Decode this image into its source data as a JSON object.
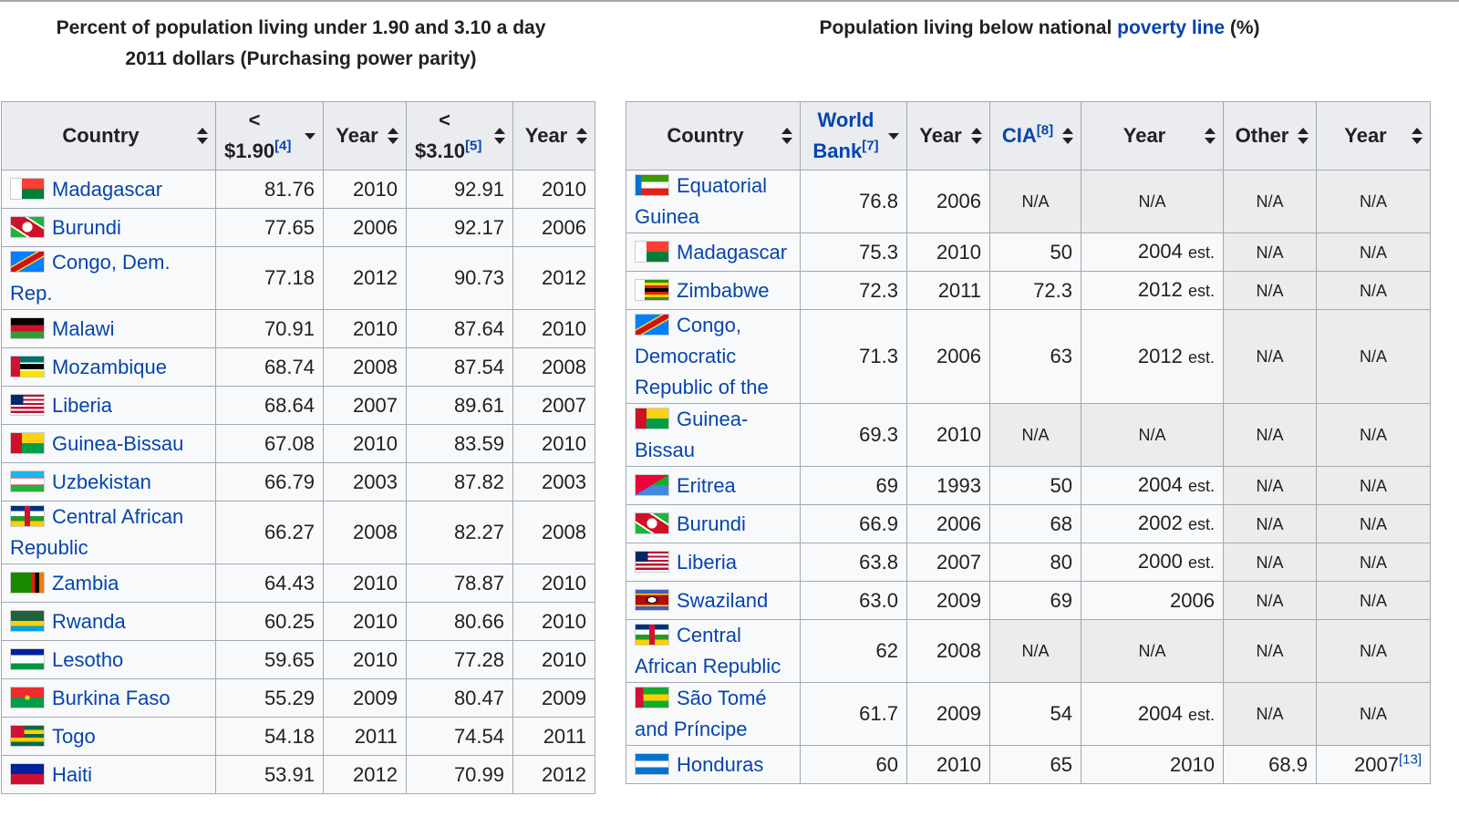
{
  "left_caption": {
    "line1": "Percent of population living under 1.90 and 3.10 a day",
    "line2": "2011 dollars (Purchasing power parity)"
  },
  "right_caption": {
    "pre": "Population living below national ",
    "link": "poverty line",
    "post": " (%)"
  },
  "colors": {
    "link": "#0645ad",
    "header_bg": "#eaecf0",
    "na_bg": "#ececec",
    "border": "#a2a9b1"
  },
  "table1": {
    "headers": {
      "country": "Country",
      "under190_a": "<",
      "under190_b": "$1.90",
      "under190_ref": "[4]",
      "year1": "Year",
      "under310_a": "<",
      "under310_b": "$3.10",
      "under310_ref": "[5]",
      "year2": "Year"
    },
    "rows": [
      {
        "country": "Madagascar",
        "flag": "madagascar-flag-icon",
        "v190": "81.76",
        "y1": "2010",
        "v310": "92.91",
        "y2": "2010"
      },
      {
        "country": "Burundi",
        "flag": "burundi-flag-icon",
        "v190": "77.65",
        "y1": "2006",
        "v310": "92.17",
        "y2": "2006"
      },
      {
        "country": "Congo, Dem. Rep.",
        "flag": "dr-congo-flag-icon",
        "v190": "77.18",
        "y1": "2012",
        "v310": "90.73",
        "y2": "2012"
      },
      {
        "country": "Malawi",
        "flag": "malawi-flag-icon",
        "v190": "70.91",
        "y1": "2010",
        "v310": "87.64",
        "y2": "2010"
      },
      {
        "country": "Mozambique",
        "flag": "mozambique-flag-icon",
        "v190": "68.74",
        "y1": "2008",
        "v310": "87.54",
        "y2": "2008"
      },
      {
        "country": "Liberia",
        "flag": "liberia-flag-icon",
        "v190": "68.64",
        "y1": "2007",
        "v310": "89.61",
        "y2": "2007"
      },
      {
        "country": "Guinea-Bissau",
        "flag": "guinea-bissau-flag-icon",
        "v190": "67.08",
        "y1": "2010",
        "v310": "83.59",
        "y2": "2010"
      },
      {
        "country": "Uzbekistan",
        "flag": "uzbekistan-flag-icon",
        "v190": "66.79",
        "y1": "2003",
        "v310": "87.82",
        "y2": "2003"
      },
      {
        "country": "Central African Republic",
        "flag": "central-african-republic-flag-icon",
        "v190": "66.27",
        "y1": "2008",
        "v310": "82.27",
        "y2": "2008"
      },
      {
        "country": "Zambia",
        "flag": "zambia-flag-icon",
        "v190": "64.43",
        "y1": "2010",
        "v310": "78.87",
        "y2": "2010"
      },
      {
        "country": "Rwanda",
        "flag": "rwanda-flag-icon",
        "v190": "60.25",
        "y1": "2010",
        "v310": "80.66",
        "y2": "2010"
      },
      {
        "country": "Lesotho",
        "flag": "lesotho-flag-icon",
        "v190": "59.65",
        "y1": "2010",
        "v310": "77.28",
        "y2": "2010"
      },
      {
        "country": "Burkina Faso",
        "flag": "burkina-faso-flag-icon",
        "v190": "55.29",
        "y1": "2009",
        "v310": "80.47",
        "y2": "2009"
      },
      {
        "country": "Togo",
        "flag": "togo-flag-icon",
        "v190": "54.18",
        "y1": "2011",
        "v310": "74.54",
        "y2": "2011"
      },
      {
        "country": "Haiti",
        "flag": "haiti-flag-icon",
        "v190": "53.91",
        "y1": "2012",
        "v310": "70.99",
        "y2": "2012"
      }
    ]
  },
  "table2": {
    "headers": {
      "country": "Country",
      "wb_a": "World",
      "wb_b": "Bank",
      "wb_ref": "[7]",
      "year1": "Year",
      "cia": "CIA",
      "cia_ref": "[8]",
      "year2": "Year",
      "other": "Other",
      "year3": "Year"
    },
    "rows": [
      {
        "country": "Equatorial Guinea",
        "flag": "equatorial-guinea-flag-icon",
        "wb": "76.8",
        "y1": "2006",
        "cia": "N/A",
        "y2": "N/A",
        "y2est": "",
        "other": "N/A",
        "y3": "N/A",
        "y3ref": ""
      },
      {
        "country": "Madagascar",
        "flag": "madagascar-flag-icon",
        "wb": "75.3",
        "y1": "2010",
        "cia": "50",
        "y2": "2004",
        "y2est": "est.",
        "other": "N/A",
        "y3": "N/A",
        "y3ref": ""
      },
      {
        "country": "Zimbabwe",
        "flag": "zimbabwe-flag-icon",
        "wb": "72.3",
        "y1": "2011",
        "cia": "72.3",
        "y2": "2012",
        "y2est": "est.",
        "other": "N/A",
        "y3": "N/A",
        "y3ref": ""
      },
      {
        "country": "Congo, Democratic Republic of the",
        "flag": "dr-congo-flag-icon",
        "wb": "71.3",
        "y1": "2006",
        "cia": "63",
        "y2": "2012",
        "y2est": "est.",
        "other": "N/A",
        "y3": "N/A",
        "y3ref": ""
      },
      {
        "country": "Guinea-Bissau",
        "flag": "guinea-bissau-flag-icon",
        "wb": "69.3",
        "y1": "2010",
        "cia": "N/A",
        "y2": "N/A",
        "y2est": "",
        "other": "N/A",
        "y3": "N/A",
        "y3ref": ""
      },
      {
        "country": "Eritrea",
        "flag": "eritrea-flag-icon",
        "wb": "69",
        "y1": "1993",
        "cia": "50",
        "y2": "2004",
        "y2est": "est.",
        "other": "N/A",
        "y3": "N/A",
        "y3ref": ""
      },
      {
        "country": "Burundi",
        "flag": "burundi-flag-icon",
        "wb": "66.9",
        "y1": "2006",
        "cia": "68",
        "y2": "2002",
        "y2est": "est.",
        "other": "N/A",
        "y3": "N/A",
        "y3ref": ""
      },
      {
        "country": "Liberia",
        "flag": "liberia-flag-icon",
        "wb": "63.8",
        "y1": "2007",
        "cia": "80",
        "y2": "2000",
        "y2est": "est.",
        "other": "N/A",
        "y3": "N/A",
        "y3ref": ""
      },
      {
        "country": "Swaziland",
        "flag": "swaziland-flag-icon",
        "wb": "63.0",
        "y1": "2009",
        "cia": "69",
        "y2": "2006",
        "y2est": "",
        "other": "N/A",
        "y3": "N/A",
        "y3ref": ""
      },
      {
        "country": "Central African Republic",
        "flag": "central-african-republic-flag-icon",
        "wb": "62",
        "y1": "2008",
        "cia": "N/A",
        "y2": "N/A",
        "y2est": "",
        "other": "N/A",
        "y3": "N/A",
        "y3ref": ""
      },
      {
        "country": "São Tomé and Príncipe",
        "flag": "sao-tome-flag-icon",
        "wb": "61.7",
        "y1": "2009",
        "cia": "54",
        "y2": "2004",
        "y2est": "est.",
        "other": "N/A",
        "y3": "N/A",
        "y3ref": ""
      },
      {
        "country": "Honduras",
        "flag": "honduras-flag-icon",
        "wb": "60",
        "y1": "2010",
        "cia": "65",
        "y2": "2010",
        "y2est": "",
        "other": "68.9",
        "y3": "2007",
        "y3ref": "[13]"
      }
    ]
  }
}
